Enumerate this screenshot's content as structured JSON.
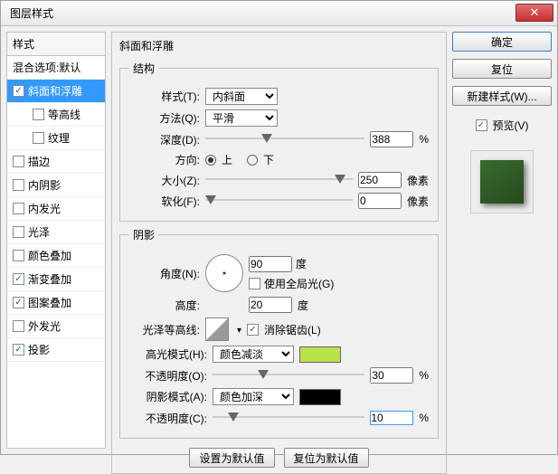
{
  "window": {
    "title": "图层样式"
  },
  "left": {
    "header": "样式",
    "blend": "混合选项:默认",
    "items": [
      {
        "label": "斜面和浮雕",
        "checked": true,
        "selected": true
      },
      {
        "label": "等高线",
        "checked": false,
        "indent": true
      },
      {
        "label": "纹理",
        "checked": false,
        "indent": true
      },
      {
        "label": "描边",
        "checked": false
      },
      {
        "label": "内阴影",
        "checked": false
      },
      {
        "label": "内发光",
        "checked": false
      },
      {
        "label": "光泽",
        "checked": false
      },
      {
        "label": "颜色叠加",
        "checked": false
      },
      {
        "label": "渐变叠加",
        "checked": true
      },
      {
        "label": "图案叠加",
        "checked": true
      },
      {
        "label": "外发光",
        "checked": false
      },
      {
        "label": "投影",
        "checked": true
      }
    ]
  },
  "panel": {
    "title": "斜面和浮雕"
  },
  "structure": {
    "legend": "结构",
    "style_label": "样式(T):",
    "style_value": "内斜面",
    "method_label": "方法(Q):",
    "method_value": "平滑",
    "depth_label": "深度(D):",
    "depth_value": "388",
    "depth_unit": "%",
    "direction_label": "方向:",
    "up": "上",
    "down": "下",
    "size_label": "大小(Z):",
    "size_value": "250",
    "size_unit": "像素",
    "soften_label": "软化(F):",
    "soften_value": "0",
    "soften_unit": "像素"
  },
  "shading": {
    "legend": "阴影",
    "angle_label": "角度(N):",
    "angle_value": "90",
    "angle_unit": "度",
    "global": "使用全局光(G)",
    "altitude_label": "高度:",
    "altitude_value": "20",
    "altitude_unit": "度",
    "gloss_label": "光泽等高线:",
    "antialias": "消除锯齿(L)",
    "hilite_mode_label": "高光模式(H):",
    "hilite_mode_value": "颜色减淡",
    "hilite_color": "#b8e24a",
    "hilite_op_label": "不透明度(O):",
    "hilite_op_value": "30",
    "hilite_op_unit": "%",
    "shadow_mode_label": "阴影模式(A):",
    "shadow_mode_value": "颜色加深",
    "shadow_color": "#000000",
    "shadow_op_label": "不透明度(C):",
    "shadow_op_value": "10",
    "shadow_op_unit": "%"
  },
  "buttons": {
    "make_default": "设置为默认值",
    "reset_default": "复位为默认值"
  },
  "right": {
    "ok": "确定",
    "cancel": "复位",
    "new_style": "新建样式(W)...",
    "preview": "预览(V)"
  }
}
